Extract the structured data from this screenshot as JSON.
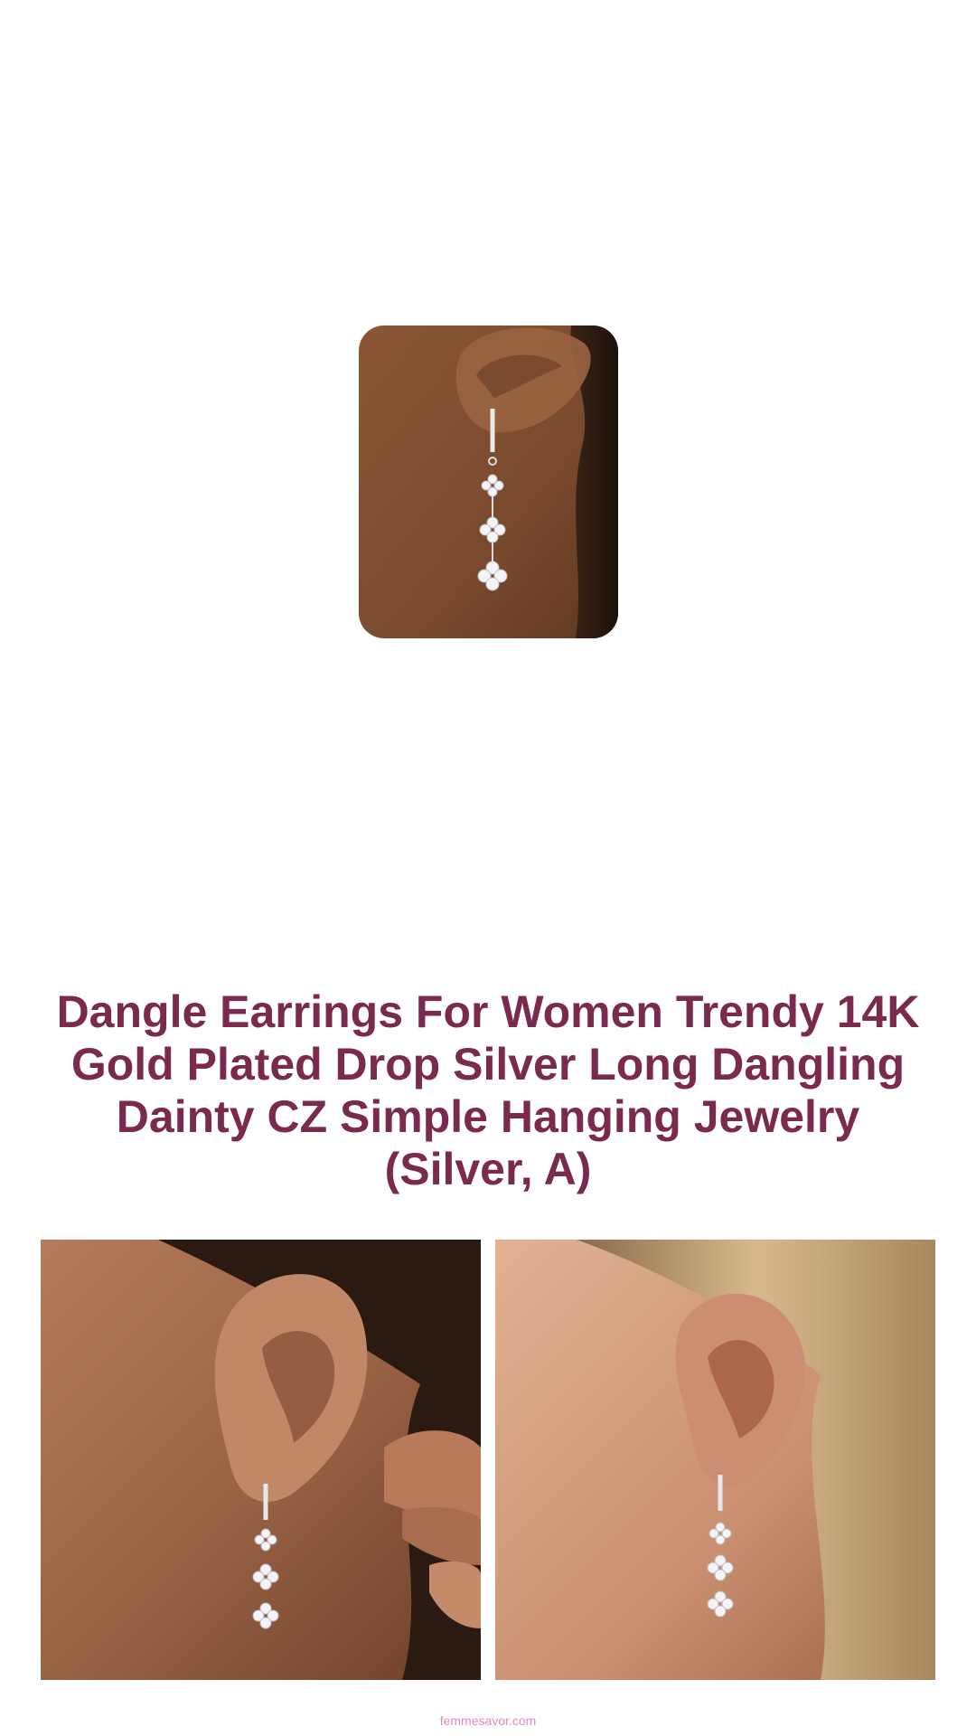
{
  "product": {
    "title": "Dangle Earrings For Women Trendy 14K Gold Plated Drop Silver Long Dangling Dainty CZ Simple Hanging Jewelry (Silver, A)"
  },
  "footer": {
    "site": "femmesavor.com"
  },
  "colors": {
    "title": "#7a2a4c",
    "footer_link": "#e08ac0",
    "background": "#ffffff"
  }
}
